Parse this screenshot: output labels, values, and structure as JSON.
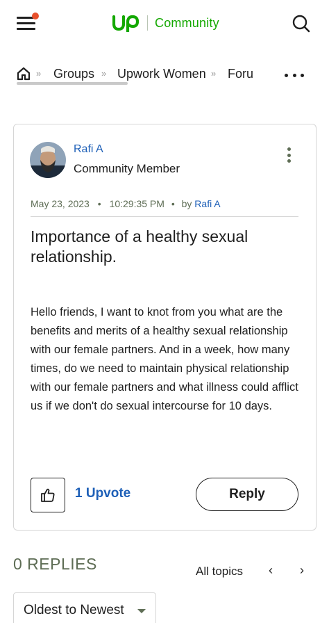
{
  "header": {
    "brand_logo": "up",
    "brand_label": "Community",
    "icons": {
      "menu": "hamburger-menu-icon",
      "search": "search-icon"
    },
    "colors": {
      "brand": "#14a800",
      "notification": "#e8502c"
    }
  },
  "breadcrumb": {
    "home_icon": "home-icon",
    "separator": "»",
    "items": [
      {
        "label": "Groups"
      },
      {
        "label": "Upwork Women"
      },
      {
        "label": "Foru"
      }
    ]
  },
  "post": {
    "author": "Rafi A",
    "rank": "Community Member",
    "date": "May 23, 2023",
    "time": "10:29:35 PM",
    "by_label": "by",
    "by_author": "Rafi A",
    "title": "Importance of a healthy sexual relationship.",
    "body": "Hello friends, I want to knot from you what are the benefits and merits of a healthy sexual relationship with our female partners. And in a week, how many times, do we need to maintain physical relationship with our female partners and what illness could afflict us if we don't do sexual intercourse for 10 days.",
    "upvote_label": "1 Upvote",
    "reply_label": "Reply",
    "colors": {
      "link": "#1d5fb7",
      "muted": "#5e6d55"
    }
  },
  "replies": {
    "count_label": "0 REPLIES",
    "all_topics_label": "All topics",
    "prev": "‹",
    "next": "›",
    "sort_label": "Oldest to Newest"
  }
}
